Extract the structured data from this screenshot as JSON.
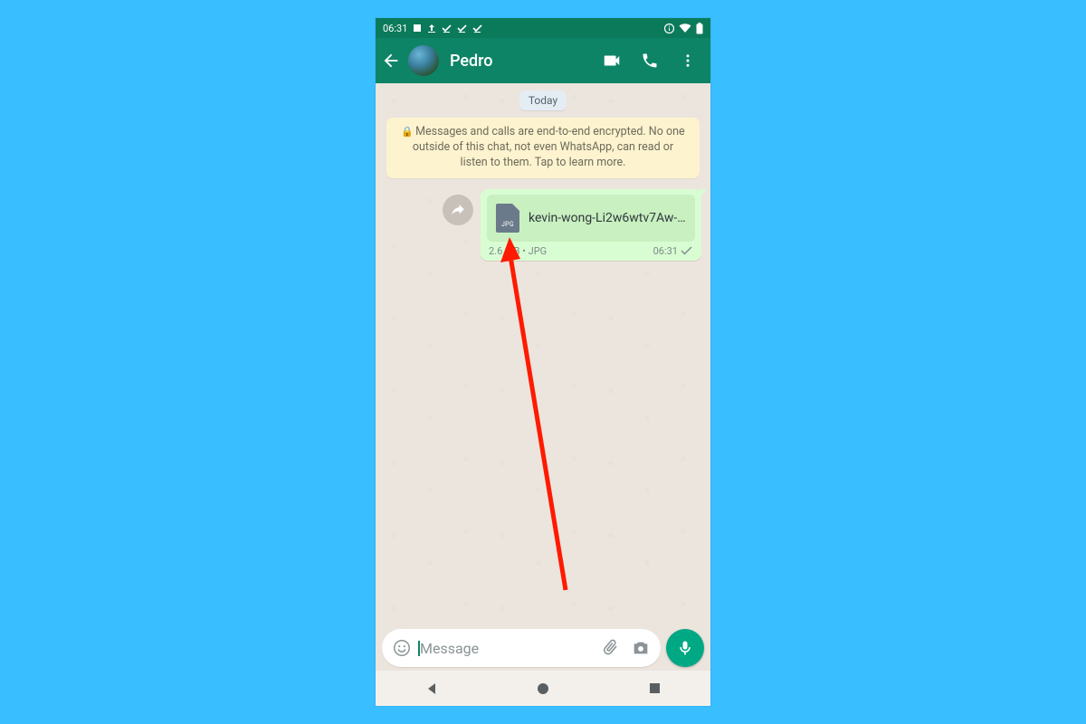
{
  "status": {
    "time": "06:31"
  },
  "header": {
    "contact_name": "Pedro"
  },
  "chat": {
    "date_label": "Today",
    "encryption_notice": "Messages and calls are end-to-end encrypted. No one outside of this chat, not even WhatsApp, can read or listen to them. Tap to learn more.",
    "message": {
      "file_name": "kevin-wong-Li2w6wtv7Aw-…",
      "file_type_badge": "JPG",
      "file_size": "2.6 MB",
      "file_ext": "JPG",
      "time": "06:31"
    }
  },
  "input": {
    "placeholder": "Message"
  }
}
